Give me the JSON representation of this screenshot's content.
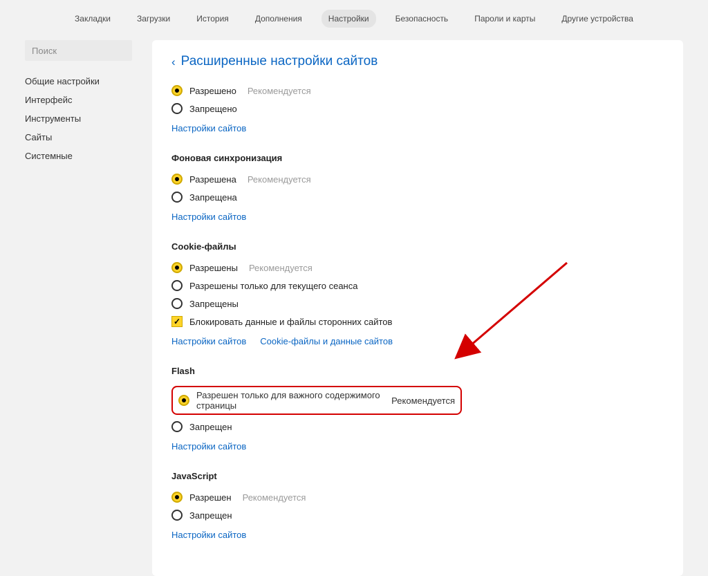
{
  "tabs": {
    "items": [
      "Закладки",
      "Загрузки",
      "История",
      "Дополнения",
      "Настройки",
      "Безопасность",
      "Пароли и карты",
      "Другие устройства"
    ],
    "active_index": 4
  },
  "sidebar": {
    "search_placeholder": "Поиск",
    "items": [
      "Общие настройки",
      "Интерфейс",
      "Инструменты",
      "Сайты",
      "Системные"
    ]
  },
  "page": {
    "title": "Расширенные настройки сайтов"
  },
  "sections": {
    "section0": {
      "opt_allow": "Разрешено",
      "opt_allow_hint": "Рекомендуется",
      "opt_deny": "Запрещено",
      "link_sites": "Настройки сайтов"
    },
    "bgsync": {
      "title": "Фоновая синхронизация",
      "opt_allow": "Разрешена",
      "opt_allow_hint": "Рекомендуется",
      "opt_deny": "Запрещена",
      "link_sites": "Настройки сайтов"
    },
    "cookies": {
      "title": "Cookie-файлы",
      "opt_allow": "Разрешены",
      "opt_allow_hint": "Рекомендуется",
      "opt_session": "Разрешены только для текущего сеанса",
      "opt_deny": "Запрещены",
      "chk_block3p": "Блокировать данные и файлы сторонних сайтов",
      "link_sites": "Настройки сайтов",
      "link_data": "Cookie-файлы и данные сайтов"
    },
    "flash": {
      "title": "Flash",
      "opt_important": "Разрешен только для важного содержимого страницы",
      "opt_important_hint": "Рекомендуется",
      "opt_deny": "Запрещен",
      "link_sites": "Настройки сайтов"
    },
    "js": {
      "title": "JavaScript",
      "opt_allow": "Разрешен",
      "opt_allow_hint": "Рекомендуется",
      "opt_deny": "Запрещен",
      "link_sites": "Настройки сайтов"
    }
  }
}
